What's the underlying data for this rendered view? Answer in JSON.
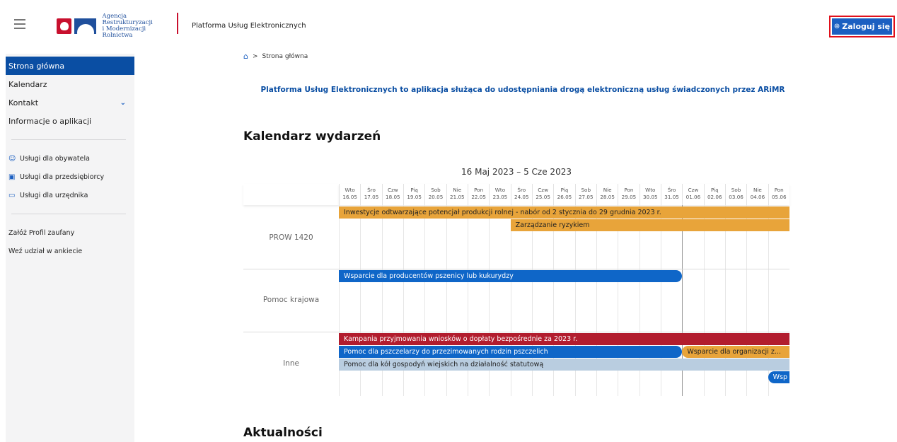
{
  "header": {
    "logo_line1": "Agencja Restrukturyzacji",
    "logo_line2": "i Modernizacji Rolnictwa",
    "app_title": "Platforma Usług Elektronicznych",
    "login_label": "Zaloguj się",
    "login_icon": "user-circle-icon"
  },
  "sidebar": {
    "nav": [
      {
        "label": "Strona główna",
        "active": true
      },
      {
        "label": "Kalendarz"
      },
      {
        "label": "Kontakt",
        "expandable": true
      },
      {
        "label": "Informacje o aplikacji"
      }
    ],
    "services": [
      {
        "label": "Usługi dla obywatela",
        "icon": "person-icon"
      },
      {
        "label": "Usługi dla przedsiębiorcy",
        "icon": "briefcase-icon"
      },
      {
        "label": "Usługi dla urzędnika",
        "icon": "monitor-icon"
      }
    ],
    "extra": [
      {
        "label": "Załóż Profil zaufany"
      },
      {
        "label": "Weź udział w ankiecie"
      }
    ]
  },
  "breadcrumb": {
    "separator": ">",
    "current": "Strona główna"
  },
  "headline": "Platforma Usług Elektronicznych to aplikacja służąca do udostępniania drogą elektroniczną usług świadczonych przez ARiMR",
  "calendar": {
    "title": "Kalendarz wydarzeń",
    "range": "16 Maj 2023 – 5 Cze 2023",
    "days": [
      {
        "dow": "Wto",
        "date": "16.05"
      },
      {
        "dow": "Śro",
        "date": "17.05"
      },
      {
        "dow": "Czw",
        "date": "18.05"
      },
      {
        "dow": "Pią",
        "date": "19.05"
      },
      {
        "dow": "Sob",
        "date": "20.05"
      },
      {
        "dow": "Nie",
        "date": "21.05"
      },
      {
        "dow": "Pon",
        "date": "22.05"
      },
      {
        "dow": "Wto",
        "date": "23.05"
      },
      {
        "dow": "Śro",
        "date": "24.05"
      },
      {
        "dow": "Czw",
        "date": "25.05"
      },
      {
        "dow": "Pią",
        "date": "26.05"
      },
      {
        "dow": "Sob",
        "date": "27.05"
      },
      {
        "dow": "Nie",
        "date": "28.05"
      },
      {
        "dow": "Pon",
        "date": "29.05"
      },
      {
        "dow": "Wto",
        "date": "30.05"
      },
      {
        "dow": "Śro",
        "date": "31.05"
      },
      {
        "dow": "Czw",
        "date": "01.06"
      },
      {
        "dow": "Pią",
        "date": "02.06"
      },
      {
        "dow": "Sob",
        "date": "03.06"
      },
      {
        "dow": "Nie",
        "date": "04.06"
      },
      {
        "dow": "Pon",
        "date": "05.06"
      }
    ],
    "rows": [
      {
        "label": "PROW 1420",
        "events": [
          {
            "label": "Inwestycje odtwarzające potencjał produkcji rolnej - nabór od 2 stycznia do 29 grudnia 2023 r.",
            "start": "16.05",
            "end": "05.06",
            "color": "orange"
          },
          {
            "label": "Zarządzanie ryzykiem",
            "start": "24.05",
            "end": "05.06",
            "color": "orange"
          }
        ]
      },
      {
        "label": "Pomoc krajowa",
        "events": [
          {
            "label": "Wsparcie dla producentów pszenicy lub kukurydzy",
            "start": "16.05",
            "end": "31.05",
            "color": "blue"
          }
        ]
      },
      {
        "label": "Inne",
        "events": [
          {
            "label": "Kampania przyjmowania wniosków o dopłaty bezpośrednie za 2023 r.",
            "start": "16.05",
            "end": "05.06",
            "color": "red"
          },
          {
            "label": "Pomoc dla pszczelarzy do przezimowanych rodzin pszczelich",
            "start": "16.05",
            "end": "31.05",
            "color": "blue"
          },
          {
            "label": "Wsparcie dla organizacji z...",
            "start": "01.06",
            "end": "05.06",
            "color": "orange"
          },
          {
            "label": "Pomoc dla kół gospodyń wiejskich na działalność statutową",
            "start": "16.05",
            "end": "05.06",
            "color": "light"
          },
          {
            "label": "Wsp",
            "start": "05.06",
            "end": "05.06",
            "color": "blue"
          }
        ]
      }
    ]
  },
  "news_title": "Aktualności"
}
